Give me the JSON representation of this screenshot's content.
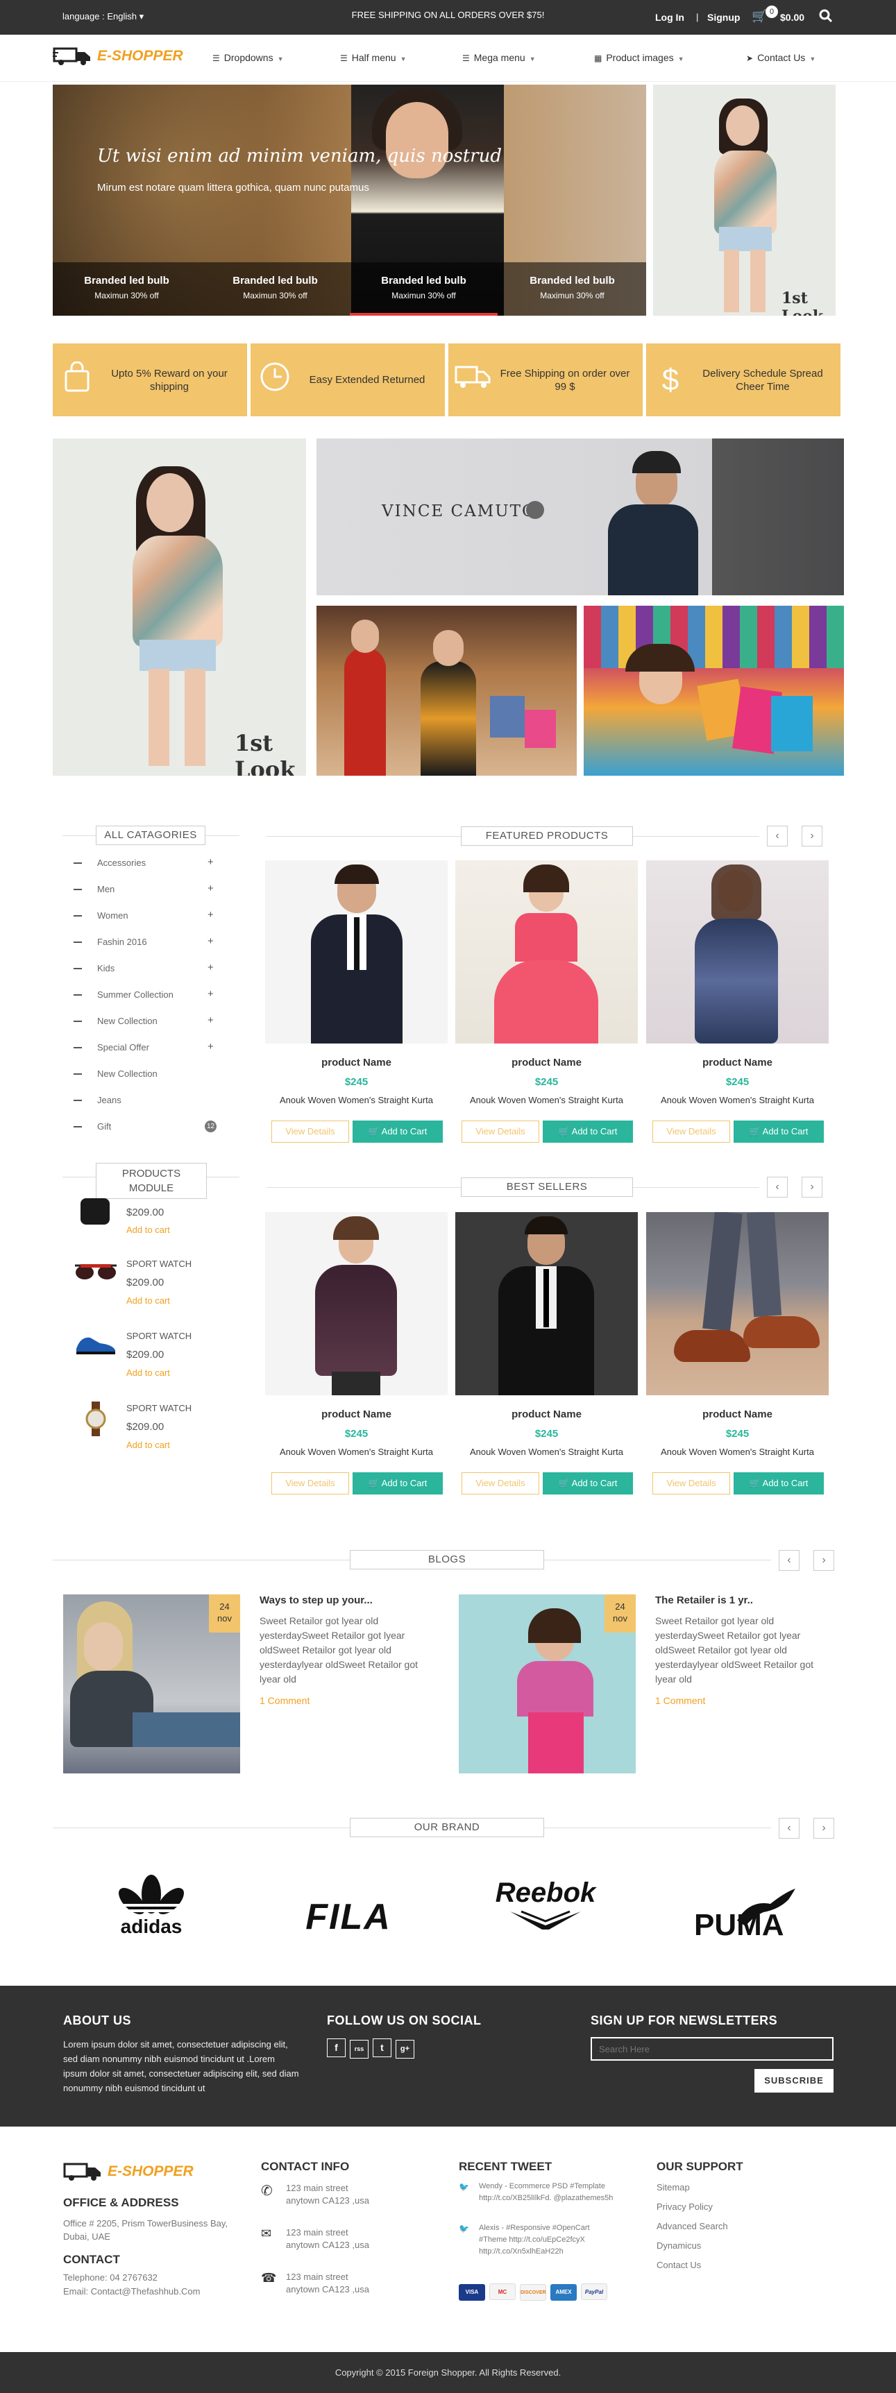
{
  "topbar": {
    "language": "language : English",
    "shipping": "FREE SHIPPING ON ALL ORDERS OVER $75!",
    "login": "Log In",
    "signup": "Signup",
    "cart_count": "0",
    "cart_total": "$0.00"
  },
  "nav": {
    "logo_text": "E-SHOPPER",
    "items": [
      "Dropdowns",
      "Half menu",
      "Mega menu",
      "Product images",
      "Contact Us"
    ]
  },
  "hero": {
    "title": "Ut wisi enim ad minim veniam, quis nostrud",
    "subtitle": "Mirum est notare quam littera gothica, quam nunc putamus",
    "tabs": [
      {
        "title": "Branded led bulb",
        "sub": "Maximun 30% off"
      },
      {
        "title": "Branded led bulb",
        "sub": "Maximun 30% off"
      },
      {
        "title": "Branded led bulb",
        "sub": "Maximun 30% off"
      },
      {
        "title": "Branded led bulb",
        "sub": "Maximun 30% off"
      }
    ],
    "side_brand": "1st Look"
  },
  "features": [
    {
      "text": "Upto 5% Reward on your shipping",
      "icon": "shopping-bag-icon"
    },
    {
      "text": "Easy Extended Returned",
      "icon": "clock-icon"
    },
    {
      "text": "Free Shipping on order over 99 $",
      "icon": "truck-icon"
    },
    {
      "text": "Delivery Schedule Spread Cheer Time",
      "icon": "dollar-icon"
    }
  ],
  "banners": {
    "left_brand": "1st Look",
    "top_brand": "VINCE CAMUTO"
  },
  "sidebar": {
    "categories_title": "ALL CATAGORIES",
    "categories": [
      {
        "label": "Accessories",
        "marker": "+"
      },
      {
        "label": "Men",
        "marker": "+"
      },
      {
        "label": "Women",
        "marker": "+"
      },
      {
        "label": "Fashin 2016",
        "marker": "+"
      },
      {
        "label": "Kids",
        "marker": "+"
      },
      {
        "label": "Summer Collection",
        "marker": "+"
      },
      {
        "label": "New Collection",
        "marker": "+"
      },
      {
        "label": "Special Offer",
        "marker": "+"
      },
      {
        "label": "New Collection",
        "marker": ""
      },
      {
        "label": "Jeans",
        "marker": ""
      },
      {
        "label": "Gift",
        "marker": "",
        "count": "12"
      }
    ],
    "module_title_1": "PRODUCTS",
    "module_title_2": "MODULE",
    "module_items": [
      {
        "name": "",
        "price": "$209.00",
        "action": "Add to cart"
      },
      {
        "name": "SPORT WATCH",
        "price": "$209.00",
        "action": "Add to cart"
      },
      {
        "name": "SPORT WATCH",
        "price": "$209.00",
        "action": "Add to cart"
      },
      {
        "name": "SPORT WATCH",
        "price": "$209.00",
        "action": "Add to cart"
      }
    ]
  },
  "featured": {
    "title": "FEATURED PRODUCTS",
    "products": [
      {
        "name": "product Name",
        "price": "$245",
        "desc": "Anouk Woven Women's Straight Kurta",
        "view": "View Details",
        "add": "Add to Cart"
      },
      {
        "name": "product Name",
        "price": "$245",
        "desc": "Anouk Woven Women's Straight Kurta",
        "view": "View Details",
        "add": "Add to Cart"
      },
      {
        "name": "product Name",
        "price": "$245",
        "desc": "Anouk Woven Women's Straight Kurta",
        "view": "View Details",
        "add": "Add to Cart"
      }
    ]
  },
  "bestsellers": {
    "title": "BEST SELLERS",
    "products": [
      {
        "name": "product Name",
        "price": "$245",
        "desc": "Anouk Woven Women's Straight Kurta",
        "view": "View Details",
        "add": "Add to Cart"
      },
      {
        "name": "product Name",
        "price": "$245",
        "desc": "Anouk Woven Women's Straight Kurta",
        "view": "View Details",
        "add": "Add to Cart"
      },
      {
        "name": "product Name",
        "price": "$245",
        "desc": "Anouk Woven Women's Straight Kurta",
        "view": "View Details",
        "add": "Add to Cart"
      }
    ]
  },
  "blogs": {
    "title": "BLOGS",
    "posts": [
      {
        "day": "24",
        "month": "nov",
        "title": "Ways to step up your...",
        "text": "Sweet Retailor got lyear old yesterdaySweet Retailor got lyear oldSweet Retailor got lyear old yesterdaylyear oldSweet Retailor got lyear old",
        "comment": "1 Comment"
      },
      {
        "day": "24",
        "month": "nov",
        "title": "The Retailer is 1 yr..",
        "text": "Sweet Retailor got lyear old yesterdaySweet Retailor got lyear oldSweet Retailor got lyear old yesterdaylyear oldSweet Retailor got lyear old",
        "comment": "1 Comment"
      }
    ]
  },
  "brands": {
    "title": "OUR BRAND",
    "items": [
      "adidas",
      "FILA",
      "Reebok",
      "PUMA"
    ]
  },
  "footer": {
    "about_title": "ABOUT US",
    "about_text": "Lorem ipsum dolor sit amet, consectetuer adipiscing elit, sed diam nonummy nibh euismod tincidunt ut .Lorem ipsum dolor sit amet, consectetuer adipiscing elit, sed diam nonummy nibh euismod tincidunt ut",
    "follow_title": "FOLLOW US ON SOCIAL",
    "social": [
      "f",
      "rss",
      "t",
      "g+"
    ],
    "newsletter_title": "SIGN UP FOR NEWSLETTERS",
    "newsletter_placeholder": "Search Here",
    "subscribe": "SUBSCRIBE",
    "logo_text": "E-SHOPPER",
    "office_title": "OFFICE & ADDRESS",
    "office_text": "Office # 2205, Prism TowerBusiness Bay, Dubai, UAE",
    "contact_title": "CONTACT",
    "telephone": "Telephone: 04 2767632",
    "email": "Email: Contact@Thefashhub.Com",
    "contact_info_title": "CONTACT INFO",
    "contact_info": [
      "123 main street anytown CA123 ,usa",
      "123 main street anytown CA123 ,usa",
      "123 main street anytown CA123 ,usa"
    ],
    "tweet_title": "RECENT TWEET",
    "tweets": [
      "Wendy - Ecommerce PSD #Template http://t.co/XB25lIlkFd. @plazathemes5h",
      "Alexis - #Responsive #OpenCart #Theme http://t.co/uEpCe2fcyX http://t.co/Xn5xlhEaH22h"
    ],
    "payments": [
      "VISA",
      "MC",
      "DISCOVER",
      "AMEX",
      "PayPal"
    ],
    "support_title": "OUR SUPPORT",
    "support_links": [
      "Sitemap",
      "Privacy Policy",
      "Advanced Search",
      "Dynamicus",
      "Contact Us"
    ],
    "copyright": "Copyright © 2015 Foreign Shopper. All Rights Reserved."
  }
}
